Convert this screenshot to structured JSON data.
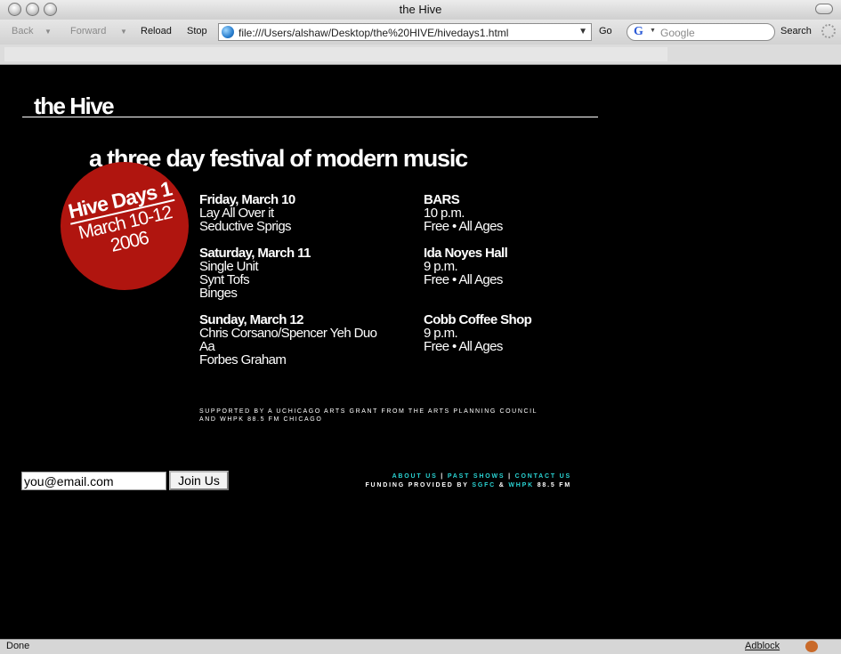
{
  "window": {
    "title": "the Hive"
  },
  "toolbar": {
    "back_label": "Back",
    "forward_label": "Forward",
    "reload_label": "Reload",
    "stop_label": "Stop",
    "url": "file:///Users/alshaw/Desktop/the%20HIVE/hivedays1.html",
    "go_label": "Go",
    "search_engine_icon": "G",
    "search_placeholder": "Google",
    "search_label": "Search"
  },
  "site": {
    "title": "the Hive",
    "tagline": "a three day festival of modern music"
  },
  "badge": {
    "title": "Hive Days 1",
    "dates": "March 10-12",
    "year": "2006",
    "color": "#b0150f"
  },
  "schedule": [
    {
      "day": "Friday, March 10",
      "acts": [
        "Lay All Over it",
        "Seductive Sprigs"
      ],
      "venue": "BARS",
      "time": "10 p.m.",
      "admission": "Free • All Ages"
    },
    {
      "day": "Saturday, March 11",
      "acts": [
        "Single Unit",
        "Synt Tofs",
        "Binges"
      ],
      "venue": "Ida Noyes Hall",
      "time": "9 p.m.",
      "admission": "Free • All Ages"
    },
    {
      "day": "Sunday, March 12",
      "acts": [
        "Chris Corsano/Spencer Yeh Duo",
        "Aa",
        "Forbes Graham"
      ],
      "venue": "Cobb Coffee Shop",
      "time": "9 p.m.",
      "admission": "Free • All Ages"
    }
  ],
  "support": {
    "line1": "Supported by a UChicago Arts Grant from the Arts Planning Council",
    "line2": "and WHPK 88.5 FM Chicago"
  },
  "signup": {
    "email_value": "you@email.com",
    "join_label": "Join Us"
  },
  "footer": {
    "about_label": "About Us",
    "past_label": "Past Shows",
    "contact_label": "Contact Us",
    "separator": "|",
    "funding_prefix": "Funding provided by",
    "sgfc_label": "SGFC",
    "amp": "&",
    "whpk_label": "WHPK",
    "whpk_suffix": "88.5 FM",
    "link_color": "#2ad4d4"
  },
  "status": {
    "text": "Done",
    "adblock_label": "Adblock"
  }
}
